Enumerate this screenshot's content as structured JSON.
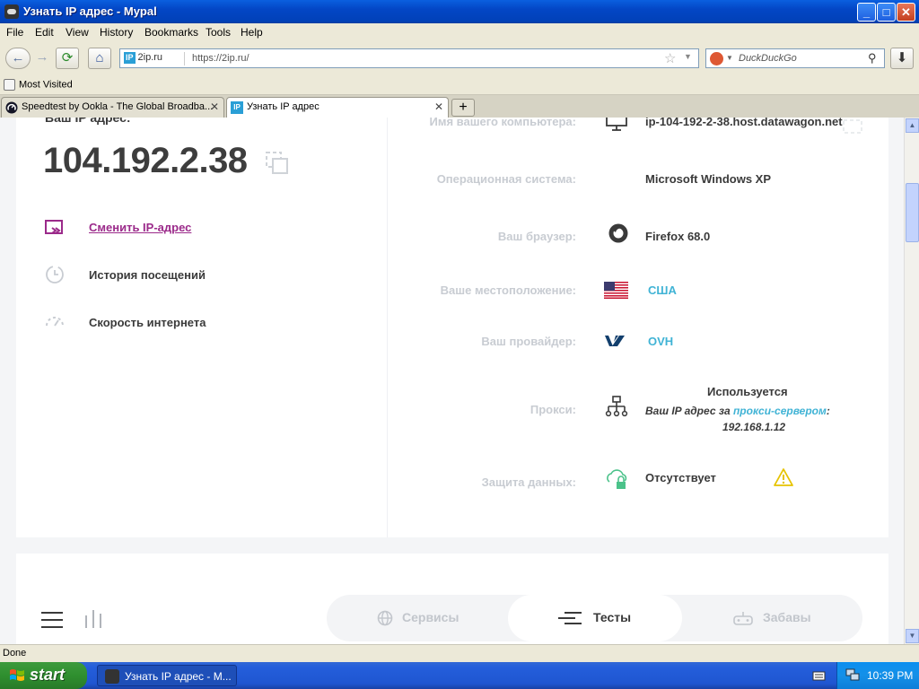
{
  "window": {
    "title": "Узнать IP адрес - Mypal",
    "min_label": "_",
    "max_label": "□",
    "close_label": "✕"
  },
  "menu": [
    "File",
    "Edit",
    "View",
    "History",
    "Bookmarks",
    "Tools",
    "Help"
  ],
  "navbar": {
    "site_badge": "IP",
    "site_name": "2ip.ru",
    "url": "https://2ip.ru/",
    "search_placeholder": "DuckDuckGo"
  },
  "bookmarks": {
    "most_visited": "Most Visited"
  },
  "tabs": [
    {
      "label": "Speedtest by Ookla - The Global Broadba..."
    },
    {
      "label": "Узнать IP адрес"
    }
  ],
  "newtab_label": "+",
  "page": {
    "ip_label": "Ваш IP адрес:",
    "ip_value": "104.192.2.38",
    "left_menu": [
      {
        "label": "Сменить IP-адрес",
        "icon": "change-ip-icon"
      },
      {
        "label": "История посещений",
        "icon": "history-icon"
      },
      {
        "label": "Скорость интернета",
        "icon": "speed-icon"
      }
    ],
    "rows": [
      {
        "label": "Имя вашего компьютера:",
        "value": "ip-104-192-2-38.host.datawagon.net",
        "icon": "monitor-icon"
      },
      {
        "label": "Операционная система:",
        "value": "Microsoft Windows XP"
      },
      {
        "label": "Ваш браузер:",
        "value": "Firefox 68.0",
        "icon": "firefox-icon"
      },
      {
        "label": "Ваше местоположение:",
        "value": "США",
        "icon": "us-flag-icon"
      },
      {
        "label": "Ваш провайдер:",
        "value": "OVH",
        "icon": "ovh-logo-icon"
      },
      {
        "label": "Прокси:"
      },
      {
        "label": "Защита данных:",
        "value": "Отсутствует",
        "icon": "cloud-lock-icon"
      }
    ],
    "proxy": {
      "status": "Используется",
      "text_before": "Ваш IP адрес за ",
      "link": "прокси-сервером",
      "text_after": ":",
      "ip": "192.168.1.12"
    },
    "bottom_tabs": [
      {
        "label": "Сервисы",
        "icon": "globe-icon",
        "active": false
      },
      {
        "label": "Тесты",
        "icon": "tests-icon",
        "active": true
      },
      {
        "label": "Забавы",
        "icon": "gamepad-icon",
        "active": false
      }
    ]
  },
  "statusbar": {
    "text": "Done"
  },
  "taskbar": {
    "start_label": "start",
    "task_label": "Узнать IP адрес - M...",
    "clock": "10:39 PM"
  }
}
